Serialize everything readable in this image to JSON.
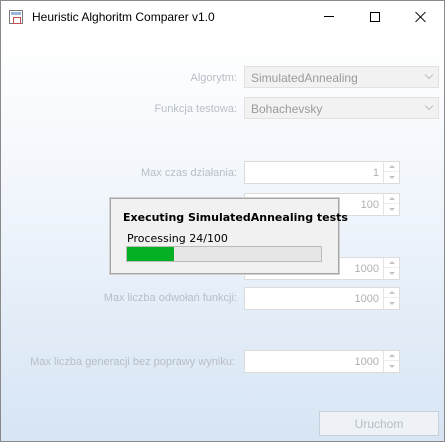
{
  "window": {
    "title": "Heuristic Alghoritm Comparer v1.0",
    "controls": [
      "minimize",
      "maximize",
      "close"
    ]
  },
  "form": {
    "algorithm_label": "Algorytm:",
    "algorithm_value": "SimulatedAnnealing",
    "function_label": "Funkcja testowa:",
    "function_value": "Bohachevsky",
    "max_time_label": "Max czas działania:",
    "max_time_value": "1",
    "field2_value": "100",
    "field3_value": "1000",
    "max_calls_label": "Max liczba odwołań funkcji:",
    "max_calls_value": "1000",
    "max_gens_label": "Max liczba generacji bez poprawy wyniku:",
    "max_gens_value": "1000",
    "run_label": "Uruchom"
  },
  "dialog": {
    "title": "Executing SimulatedAnnealing tests",
    "status": "Processing 24/100",
    "progress_fraction": 0.24
  },
  "colors": {
    "progress_fill": "#06b025",
    "disabled_text": "#b8bec6"
  },
  "icons": {
    "app": "window-app-icon",
    "minimize": "minimize-icon",
    "maximize": "maximize-icon",
    "close": "close-icon",
    "dropdown": "chevron-down-icon",
    "spin_up": "spin-up-icon",
    "spin_down": "spin-down-icon"
  }
}
